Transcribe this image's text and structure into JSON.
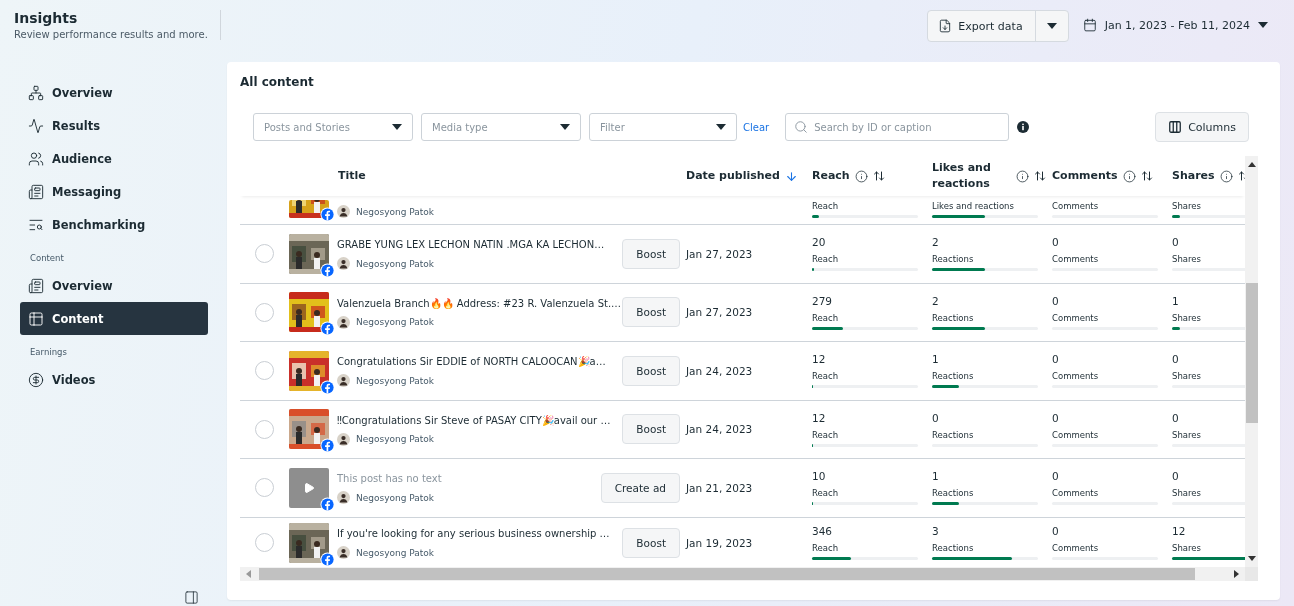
{
  "header": {
    "title": "Insights",
    "subtitle": "Review performance results and more."
  },
  "toolbar": {
    "export_button": "Export data",
    "date_range": "Jan 1, 2023 - Feb 11, 2024"
  },
  "sidebar": {
    "groups": [
      {
        "items": [
          {
            "label": "Overview",
            "selected": false
          },
          {
            "label": "Results",
            "selected": false
          },
          {
            "label": "Audience",
            "selected": false
          },
          {
            "label": "Messaging",
            "selected": false
          },
          {
            "label": "Benchmarking",
            "selected": false
          }
        ]
      },
      {
        "heading": "Content",
        "items": [
          {
            "label": "Overview",
            "selected": false
          },
          {
            "label": "Content",
            "selected": true
          }
        ]
      },
      {
        "heading": "Earnings",
        "items": [
          {
            "label": "Videos",
            "selected": false
          }
        ]
      }
    ]
  },
  "card": {
    "title": "All content",
    "filters": [
      {
        "placeholder": "Posts and Stories"
      },
      {
        "placeholder": "Media type"
      },
      {
        "placeholder": "Filter"
      }
    ],
    "clear_link": "Clear",
    "search": {
      "placeholder": "Search by ID or caption"
    },
    "columns_button": "Columns"
  },
  "table": {
    "columns": [
      {
        "label": "Title",
        "kind": "title",
        "sorted": false
      },
      {
        "label": "Date published",
        "kind": "date",
        "sorted": true
      },
      {
        "label": "Reach",
        "kind": "metric",
        "sorted": false
      },
      {
        "label": "Likes and reactions",
        "kind": "metric",
        "sorted": false
      },
      {
        "label": "Comments",
        "kind": "metric",
        "sorted": false
      },
      {
        "label": "Shares",
        "kind": "metric",
        "sorted": false
      }
    ],
    "rows": [
      {
        "kind": "partial",
        "thumbnail": {
          "kind": "picture"
        },
        "author": "Negosyong Patok",
        "metrics": [
          {
            "label": "Reach",
            "level": 0.07
          },
          {
            "label": "Likes and reactions",
            "level": 0.5
          },
          {
            "label": "Comments",
            "level": 0
          },
          {
            "label": "Shares",
            "level": 0.08
          }
        ]
      },
      {
        "kind": "post",
        "selected": false,
        "thumbnail": {
          "kind": "picture"
        },
        "title": "GRABE YUNG LEX LECHON NATIN .MGA KA LECHON…",
        "muted": false,
        "author": "Negosyong Patok",
        "action": "Boost",
        "date": "Jan 27, 2023",
        "metrics": [
          {
            "value": "20",
            "label": "Reach",
            "level": 0.02
          },
          {
            "value": "2",
            "label": "Reactions",
            "level": 0.5
          },
          {
            "value": "0",
            "label": "Comments",
            "level": 0
          },
          {
            "value": "0",
            "label": "Shares",
            "level": 0
          }
        ]
      },
      {
        "kind": "post",
        "selected": false,
        "thumbnail": {
          "kind": "picture"
        },
        "title": "Valenzuela Branch🔥🔥 Address: #23 R. Valenzuela St.…",
        "muted": false,
        "author": "Negosyong Patok",
        "action": "Boost",
        "date": "Jan 27, 2023",
        "metrics": [
          {
            "value": "279",
            "label": "Reach",
            "level": 0.29
          },
          {
            "value": "2",
            "label": "Reactions",
            "level": 0.5
          },
          {
            "value": "0",
            "label": "Comments",
            "level": 0
          },
          {
            "value": "1",
            "label": "Shares",
            "level": 0.08
          }
        ]
      },
      {
        "kind": "post",
        "selected": false,
        "thumbnail": {
          "kind": "picture"
        },
        "title": "Congratulations Sir EDDIE of NORTH CALOOCAN🎉a…",
        "muted": false,
        "author": "Negosyong Patok",
        "action": "Boost",
        "date": "Jan 24, 2023",
        "metrics": [
          {
            "value": "12",
            "label": "Reach",
            "level": 0.01
          },
          {
            "value": "1",
            "label": "Reactions",
            "level": 0.25
          },
          {
            "value": "0",
            "label": "Comments",
            "level": 0
          },
          {
            "value": "0",
            "label": "Shares",
            "level": 0
          }
        ]
      },
      {
        "kind": "post",
        "selected": false,
        "thumbnail": {
          "kind": "picture"
        },
        "title": "‼Congratulations Sir Steve of PASAY CITY🎉avail our …",
        "muted": false,
        "author": "Negosyong Patok",
        "action": "Boost",
        "date": "Jan 24, 2023",
        "metrics": [
          {
            "value": "12",
            "label": "Reach",
            "level": 0.01
          },
          {
            "value": "0",
            "label": "Reactions",
            "level": 0
          },
          {
            "value": "0",
            "label": "Comments",
            "level": 0
          },
          {
            "value": "0",
            "label": "Shares",
            "level": 0
          }
        ]
      },
      {
        "kind": "post",
        "selected": false,
        "thumbnail": {
          "kind": "video"
        },
        "title": "This post has no text",
        "muted": true,
        "author": "Negosyong Patok",
        "action": "Create ad",
        "date": "Jan 21, 2023",
        "metrics": [
          {
            "value": "10",
            "label": "Reach",
            "level": 0.01
          },
          {
            "value": "1",
            "label": "Reactions",
            "level": 0.25
          },
          {
            "value": "0",
            "label": "Comments",
            "level": 0
          },
          {
            "value": "0",
            "label": "Shares",
            "level": 0
          }
        ]
      },
      {
        "kind": "post",
        "selected": false,
        "thumbnail": {
          "kind": "picture"
        },
        "title": "If you're looking for any serious business ownership …",
        "muted": false,
        "author": "Negosyong Patok",
        "action": "Boost",
        "date": "Jan 19, 2023",
        "metrics": [
          {
            "value": "346",
            "label": "Reach",
            "level": 0.37
          },
          {
            "value": "3",
            "label": "Reactions",
            "level": 0.75
          },
          {
            "value": "0",
            "label": "Comments",
            "level": 0
          },
          {
            "value": "12",
            "label": "Shares",
            "level": 1
          }
        ]
      }
    ]
  }
}
